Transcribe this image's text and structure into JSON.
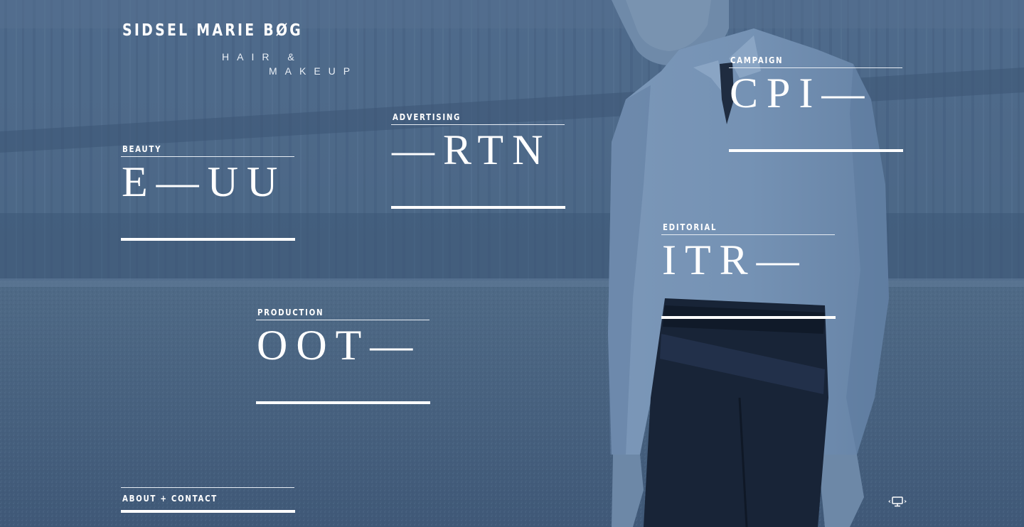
{
  "brand": {
    "name": "SIDSEL MARIE BØG",
    "tagline_line1": "HAIR &",
    "tagline_line2": "MAKEUP"
  },
  "categories": {
    "beauty": {
      "label": "BEAUTY",
      "code": "E—UU"
    },
    "advertising": {
      "label": "ADVERTISING",
      "code": "—RTN"
    },
    "production": {
      "label": "PRODUCTION",
      "code": "OOT—"
    },
    "editorial": {
      "label": "EDITORIAL",
      "code": "ITR—"
    },
    "campaign": {
      "label": "CAMPAIGN",
      "code": "CPI—"
    }
  },
  "footer": {
    "about_label": "ABOUT + CONTACT"
  },
  "icons": {
    "view_toggle": "monitor-icon"
  },
  "colors": {
    "overlay": "#4a6688",
    "text": "#ffffff"
  }
}
